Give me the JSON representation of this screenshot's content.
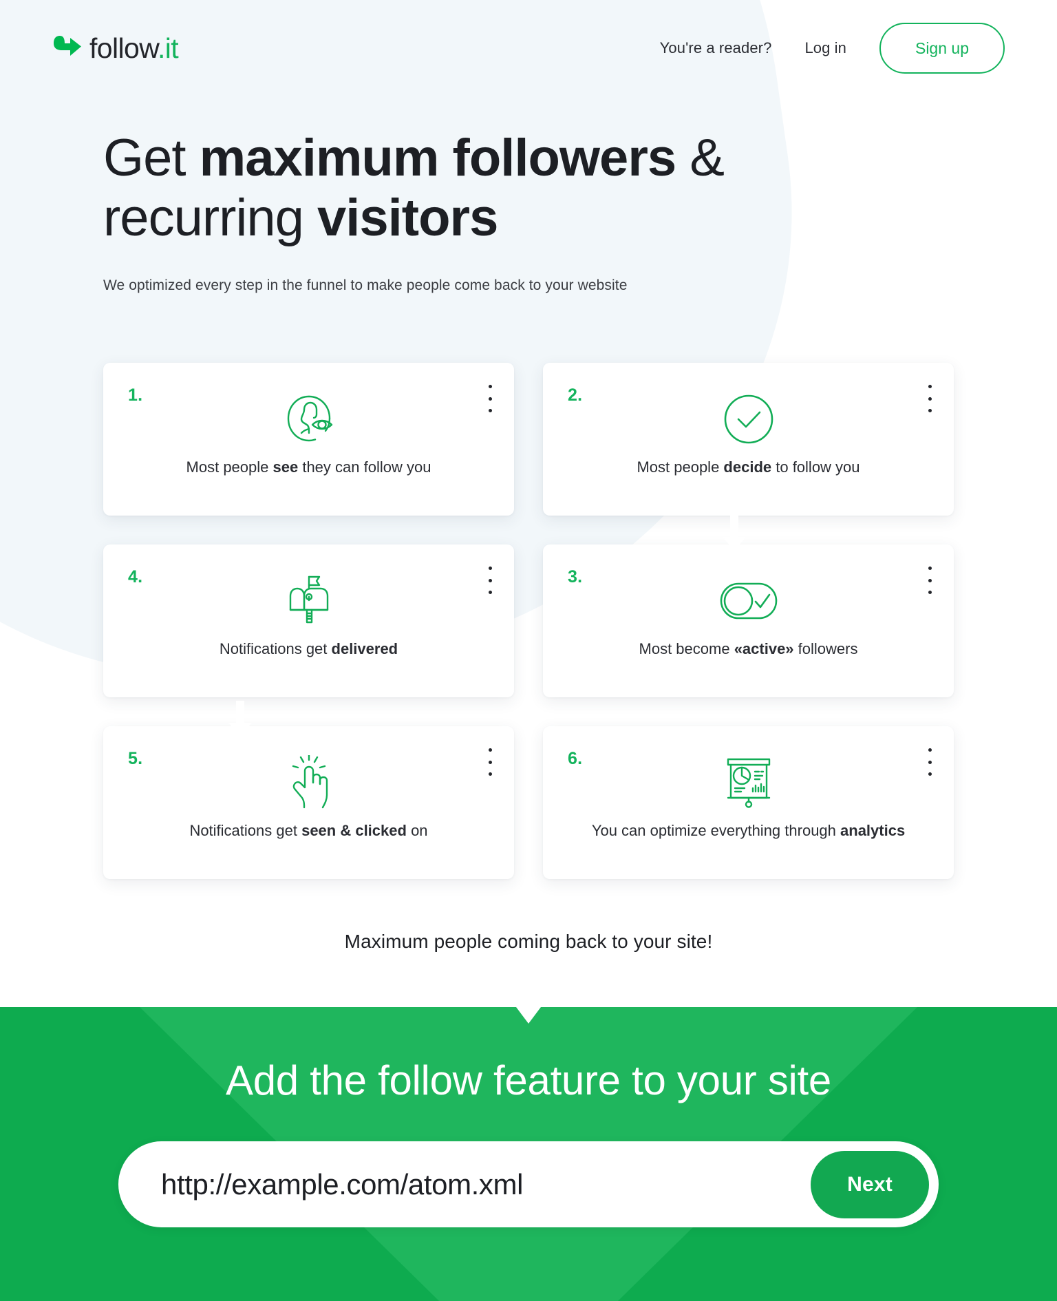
{
  "brand": {
    "accent_green": "#13b35c",
    "cta_green": "#0eab4f",
    "hero_tint": "#f2f7fa",
    "logo_name": "follow",
    "logo_tld": ".it"
  },
  "header": {
    "nav": [
      {
        "label": "You're a reader?"
      },
      {
        "label": "Log in"
      }
    ],
    "signup_label": "Sign up"
  },
  "hero": {
    "headline_part1": "Get ",
    "headline_bold1": "maximum followers",
    "headline_part2": " & recurring ",
    "headline_bold2": "visitors",
    "subhead": "We optimized every step in the funnel to make people come back to your website"
  },
  "steps": [
    {
      "number": "1.",
      "icon": "person-eye-icon",
      "text_before": "Most people ",
      "text_bold": "see",
      "text_after": " they can follow you"
    },
    {
      "number": "2.",
      "icon": "check-circle-icon",
      "text_before": "Most people ",
      "text_bold": "decide",
      "text_after": " to follow you"
    },
    {
      "number": "4.",
      "icon": "mailbox-icon",
      "text_before": "Notifications get ",
      "text_bold": "delivered",
      "text_after": ""
    },
    {
      "number": "3.",
      "icon": "toggle-check-icon",
      "text_before": "Most become ",
      "text_bold": "«active»",
      "text_after": " followers"
    },
    {
      "number": "5.",
      "icon": "tap-hand-icon",
      "text_before": "Notifications get ",
      "text_bold": "seen & clicked",
      "text_after": " on"
    },
    {
      "number": "6.",
      "icon": "analytics-board-icon",
      "text_before": "You can optimize everything through ",
      "text_bold": "analytics",
      "text_after": ""
    }
  ],
  "summary": "Maximum people coming back to your site!",
  "cta": {
    "title": "Add the follow feature to your site",
    "input_value": "http://example.com/atom.xml",
    "input_placeholder": "http://example.com/atom.xml",
    "next_label": "Next"
  }
}
